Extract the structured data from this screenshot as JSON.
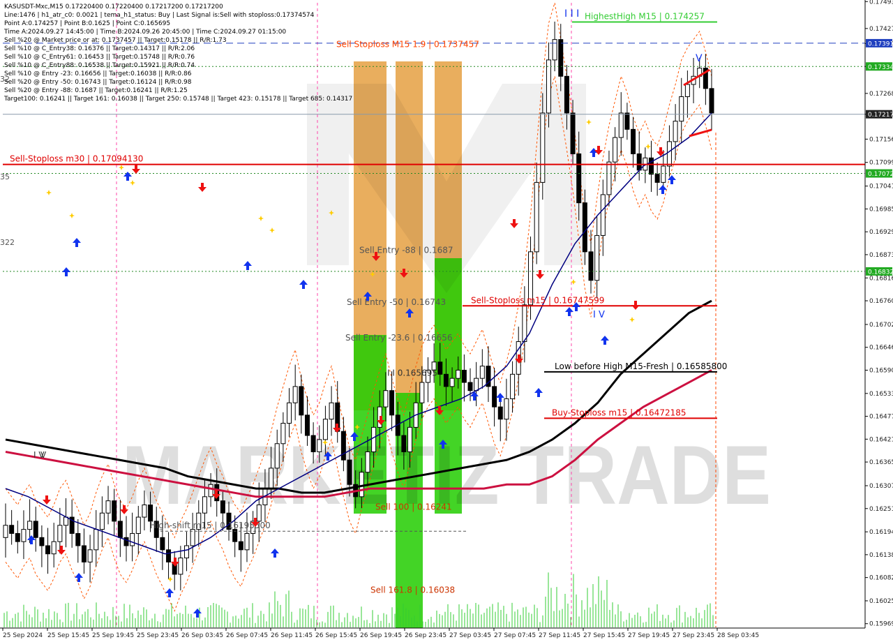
{
  "info_lines": [
    "KASUSDT-Mxc,M15  0.17220400 0.17220400 0.17217200 0.17217200",
    "Line:1476 | h1_atr_c0: 0.0021 | tema_h1_status: Buy | Last Signal is:Sell with stoploss:0.17374574",
    "Point A:0.174257 | Point B:0.1625 | Point C:0.165695",
    "Time A:2024.09.27 14:45:00 | Time B:2024.09.26 20:45:00 | Time C:2024.09.27 01:15:00",
    "Sell %20 @ Market price or at: 0.1737457 || Target:0.15178 || R/R:1.73",
    "Sell %10 @ C_Entry38: 0.16376 || Target:0.14317 || R/R:2.06",
    "Sell %10 @ C_Entry61: 0.16453 || Target:0.15748 || R/R:0.76",
    "Sell %10 @ C_Entry88: 0.16538 || Target:0.15921 || R/R:0.74",
    "Sell %10 @ Entry -23: 0.16656 || Target:0.16038 || R/R:0.86",
    "Sell %20 @ Entry -50: 0.16743 || Target:0.16124 || R/R:0.98",
    "Sell %20 @ Entry -88: 0.1687 || Target:0.16241 || R/R:1.25",
    "Target100: 0.16241 || Target 161: 0.16038 || Target 250: 0.15748 || Target 423: 0.15178 || Target 685: 0.14317"
  ],
  "watermark": "MARKETIZ TRADE",
  "levels": [
    {
      "label": "HighestHigh   M15 | 0.174257",
      "value": 0.17443,
      "color": "#33cc33"
    },
    {
      "label": "Sell Stoploss M15 1.9 | 0.1737457",
      "value": 0.17374574,
      "color": "#ff4400"
    },
    {
      "label": "Sell-Stoploss m30 | 0.17094130",
      "value": 0.1709413,
      "color": "#e00000"
    },
    {
      "label": "Sell Entry -88 | 0.1687",
      "value": 0.1687,
      "color": "#555555"
    },
    {
      "label": "Sell-Stoploss m15 | 0.16747599",
      "value": 0.16747599,
      "color": "#e00000"
    },
    {
      "label": "Sell Entry -50 | 0.16743",
      "value": 0.16743,
      "color": "#555555"
    },
    {
      "label": "I I 0.165695",
      "value": 0.165695,
      "color": "#333333"
    },
    {
      "label": "Sell Entry -23.6 | 0.16656",
      "value": 0.16656,
      "color": "#555555"
    },
    {
      "label": "Low before High   M15-Fresh | 0.16585800",
      "value": 0.165858,
      "color": "#000000"
    },
    {
      "label": "Buy-Stoploss m15 | 0.16472185",
      "value": 0.16472185,
      "color": "#e00000"
    },
    {
      "label": "Sell 100 | 0.16241",
      "value": 0.16241,
      "color": "#cc3300"
    },
    {
      "label": "High-shift m15 | 0.16195500",
      "value": 0.161955,
      "color": "#555555"
    },
    {
      "label": "Sell 161.8 | 0.16038",
      "value": 0.16038,
      "color": "#cc3300"
    }
  ],
  "price_badges": [
    {
      "text": "0.17391",
      "value": 0.17391,
      "color": "#1f3fbf"
    },
    {
      "text": "0.17334",
      "value": 0.17334,
      "color": "#22aa22"
    },
    {
      "text": "0.17217",
      "value": 0.17217,
      "color": "#222222"
    },
    {
      "text": "0.17072",
      "value": 0.17072,
      "color": "#22aa22"
    },
    {
      "text": "0.16832",
      "value": 0.16832,
      "color": "#22aa22"
    }
  ],
  "left_clipped_labels": [
    "35",
    "322",
    "32"
  ],
  "markers": [
    "I I I",
    "V",
    "V",
    "I V",
    "I V"
  ],
  "chart_data": {
    "type": "candlestick",
    "symbol": "KASUSDT-Mxc",
    "timeframe": "M15",
    "ylim": [
      0.1596,
      0.1749
    ],
    "y_ticks": [
      "0.17493",
      "0.17427",
      "0.17390",
      "0.17334",
      "0.17268",
      "0.17217",
      "0.17156",
      "0.17099",
      "0.17041",
      "0.16985",
      "0.16929",
      "0.16873",
      "0.16816",
      "0.16760",
      "0.16702",
      "0.16646",
      "0.16590",
      "0.16533",
      "0.16477",
      "0.16421",
      "0.16365",
      "0.16307",
      "0.16251",
      "0.16194",
      "0.16138",
      "0.16082",
      "0.16025",
      "0.15969"
    ],
    "x_labels": [
      "25 Sep 2024",
      "25 Sep 15:45",
      "25 Sep 19:45",
      "25 Sep 23:45",
      "26 Sep 03:45",
      "26 Sep 07:45",
      "26 Sep 11:45",
      "26 Sep 15:45",
      "26 Sep 19:45",
      "26 Sep 23:45",
      "27 Sep 03:45",
      "27 Sep 07:45",
      "27 Sep 11:45",
      "27 Sep 15:45",
      "27 Sep 19:45",
      "27 Sep 23:45",
      "28 Sep 03:45"
    ],
    "close_path": [
      0.1621,
      0.1619,
      0.1617,
      0.162,
      0.1622,
      0.1618,
      0.1616,
      0.1614,
      0.1617,
      0.1621,
      0.1623,
      0.1619,
      0.1616,
      0.1612,
      0.1615,
      0.162,
      0.1624,
      0.1627,
      0.1622,
      0.1618,
      0.1616,
      0.1619,
      0.1623,
      0.1626,
      0.1622,
      0.1618,
      0.1615,
      0.1612,
      0.1609,
      0.1613,
      0.1616,
      0.162,
      0.1624,
      0.1628,
      0.1631,
      0.1627,
      0.1624,
      0.162,
      0.1617,
      0.1615,
      0.1619,
      0.1622,
      0.1626,
      0.163,
      0.1635,
      0.1641,
      0.1646,
      0.1651,
      0.1655,
      0.1648,
      0.1643,
      0.1639,
      0.1642,
      0.1647,
      0.1651,
      0.1644,
      0.1637,
      0.1631,
      0.1628,
      0.1634,
      0.1639,
      0.1645,
      0.165,
      0.1654,
      0.1648,
      0.1643,
      0.1639,
      0.1645,
      0.1651,
      0.1656,
      0.1659,
      0.1661,
      0.1658,
      0.1655,
      0.1657,
      0.1659,
      0.1656,
      0.1654,
      0.1657,
      0.166,
      0.1655,
      0.165,
      0.1647,
      0.1652,
      0.1658,
      0.1666,
      0.1675,
      0.1688,
      0.1705,
      0.1722,
      0.1735,
      0.174,
      0.1731,
      0.1722,
      0.1712,
      0.17,
      0.1688,
      0.1681,
      0.1692,
      0.1702,
      0.171,
      0.1716,
      0.1722,
      0.1718,
      0.1712,
      0.1708,
      0.1711,
      0.1707,
      0.1705,
      0.1709,
      0.1715,
      0.172,
      0.1726,
      0.1729,
      0.1731,
      0.1733,
      0.1728,
      0.1722
    ],
    "ema_slow": [
      0.1642,
      0.1641,
      0.164,
      0.1639,
      0.1638,
      0.1637,
      0.1636,
      0.1635,
      0.1633,
      0.1632,
      0.1631,
      0.163,
      0.163,
      0.1629,
      0.1629,
      0.163,
      0.1631,
      0.1632,
      0.1633,
      0.1634,
      0.1635,
      0.1636,
      0.1637,
      0.1639,
      0.1642,
      0.1646,
      0.1651,
      0.1658,
      0.1663,
      0.1668,
      0.1673,
      0.1676
    ],
    "ema_mid": [
      0.1639,
      0.1638,
      0.1637,
      0.1636,
      0.1635,
      0.1634,
      0.1633,
      0.1632,
      0.1631,
      0.163,
      0.1629,
      0.1628,
      0.1628,
      0.1628,
      0.1628,
      0.1629,
      0.163,
      0.163,
      0.163,
      0.163,
      0.163,
      0.163,
      0.1631,
      0.1631,
      0.1633,
      0.1637,
      0.1642,
      0.1646,
      0.165,
      0.1653,
      0.1656,
      0.1659
    ],
    "ema_fast": [
      0.163,
      0.1628,
      0.1625,
      0.1622,
      0.162,
      0.1618,
      0.1616,
      0.1614,
      0.1615,
      0.1618,
      0.1622,
      0.1627,
      0.163,
      0.1633,
      0.1636,
      0.1639,
      0.1642,
      0.1645,
      0.1648,
      0.165,
      0.1652,
      0.1655,
      0.166,
      0.1668,
      0.168,
      0.169,
      0.1697,
      0.1703,
      0.1709,
      0.1712,
      0.1716,
      0.1722
    ]
  },
  "colors": {
    "sell_zone_orange": "#e08c1a",
    "sell_zone_green": "#22cc00",
    "bull_candle": "#00aa00",
    "bear_candle": "#000000",
    "ema_fast": "#000080",
    "ema_mid": "#cc1040",
    "ema_slow": "#000000",
    "stoploss_line": "#e00000",
    "buy_arrow": "#1133ee",
    "sell_arrow": "#ee1111"
  }
}
